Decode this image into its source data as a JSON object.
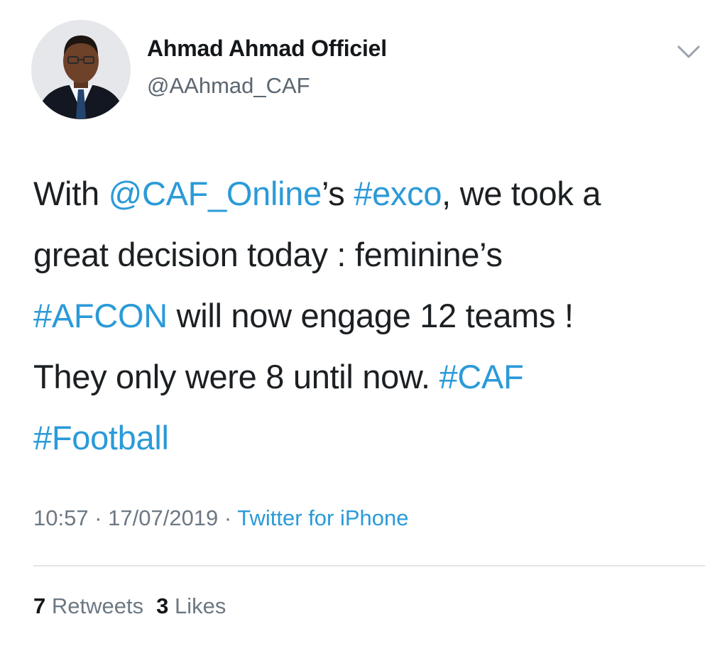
{
  "author": {
    "display_name": "Ahmad Ahmad Officiel",
    "handle": "@AAhmad_CAF"
  },
  "tweet": {
    "lines": [
      [
        {
          "text": "With ",
          "link": false
        },
        {
          "text": "@CAF_Online",
          "link": true
        },
        {
          "text": "’s ",
          "link": false
        },
        {
          "text": "#exco",
          "link": true
        },
        {
          "text": ", we took a",
          "link": false
        }
      ],
      [
        {
          "text": "great decision today : feminine’s",
          "link": false
        }
      ],
      [
        {
          "text": "#AFCON",
          "link": true
        },
        {
          "text": " will now engage 12 teams !",
          "link": false
        }
      ],
      [
        {
          "text": "They only were 8 until now. ",
          "link": false
        },
        {
          "text": "#CAF",
          "link": true
        }
      ],
      [
        {
          "text": "#Football",
          "link": true
        }
      ]
    ]
  },
  "meta": {
    "time": "10:57",
    "separator": " · ",
    "date": "17/07/2019",
    "source": "Twitter for iPhone"
  },
  "stats": {
    "retweets_count": "7",
    "retweets_label": "Retweets",
    "likes_count": "3",
    "likes_label": "Likes"
  },
  "icons": {
    "menu": "chevron-down-icon"
  },
  "colors": {
    "link": "#2b9ad8",
    "secondary_text": "#6d7883",
    "primary_text": "#1c2023",
    "divider": "#e3e6e9"
  }
}
